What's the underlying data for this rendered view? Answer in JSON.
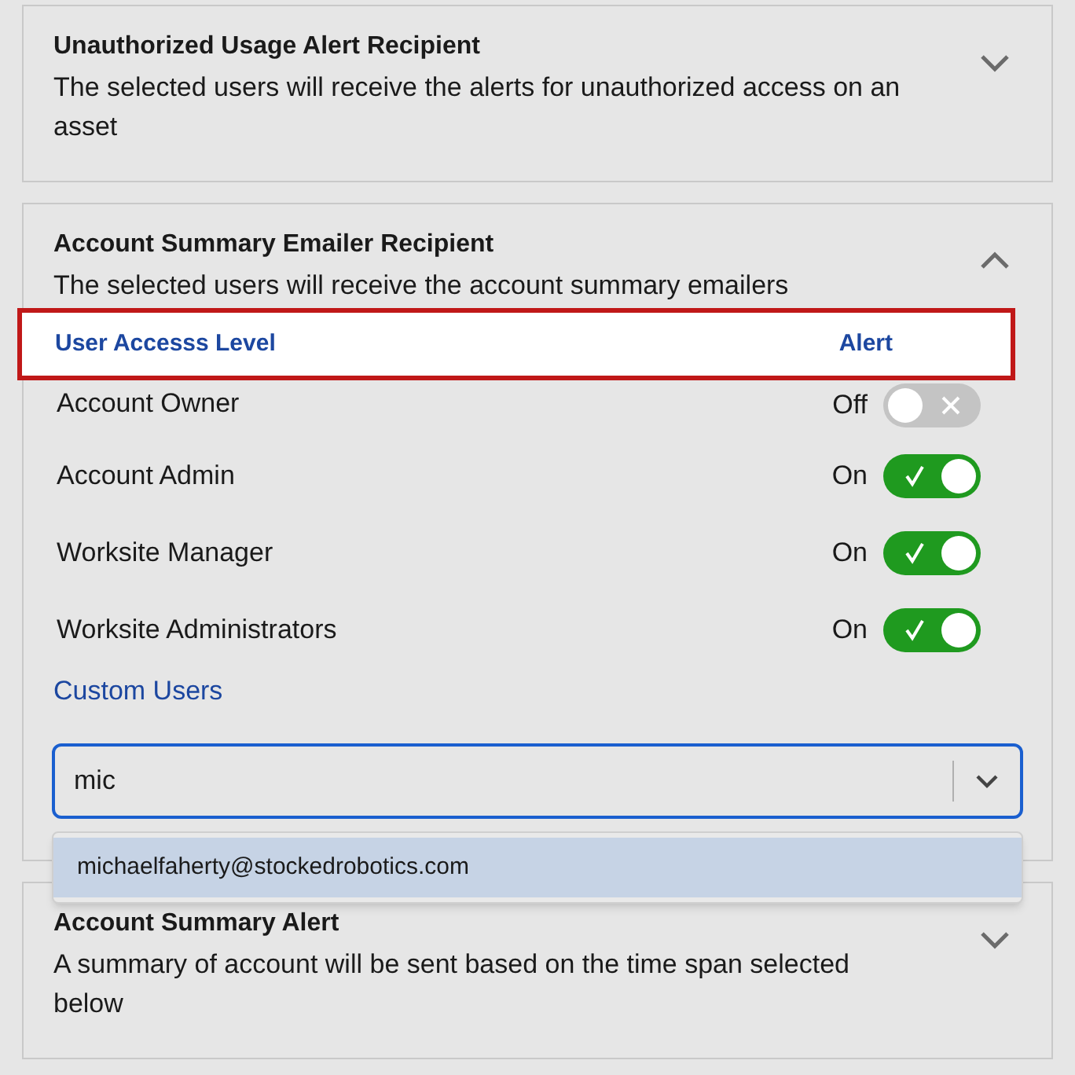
{
  "sections": [
    {
      "title": "Unauthorized Usage Alert Recipient",
      "description": "The selected users will receive the alerts for unauthorized access on an asset",
      "expanded": false
    },
    {
      "title": "Account Summary Emailer Recipient",
      "description": "The selected users will receive the account summary emailers",
      "expanded": true,
      "table_header": {
        "highlighted": true,
        "column_1": "User Accesss Level",
        "column_2": "Alert"
      },
      "rows": [
        {
          "label": "Account Owner",
          "state_text": "Off",
          "on": false
        },
        {
          "label": "Account Admin",
          "state_text": "On",
          "on": true
        },
        {
          "label": "Worksite Manager",
          "state_text": "On",
          "on": true
        },
        {
          "label": "Worksite Administrators",
          "state_text": "On",
          "on": true
        }
      ],
      "custom_users": {
        "label": "Custom Users",
        "search_value": "mic",
        "options": [
          {
            "label": "michaelfaherty@stockedrobotics.com",
            "selected": true
          }
        ]
      }
    },
    {
      "title": "Account Summary Alert",
      "description": "A summary of account will be sent based on the time span selected below",
      "expanded": false
    }
  ]
}
